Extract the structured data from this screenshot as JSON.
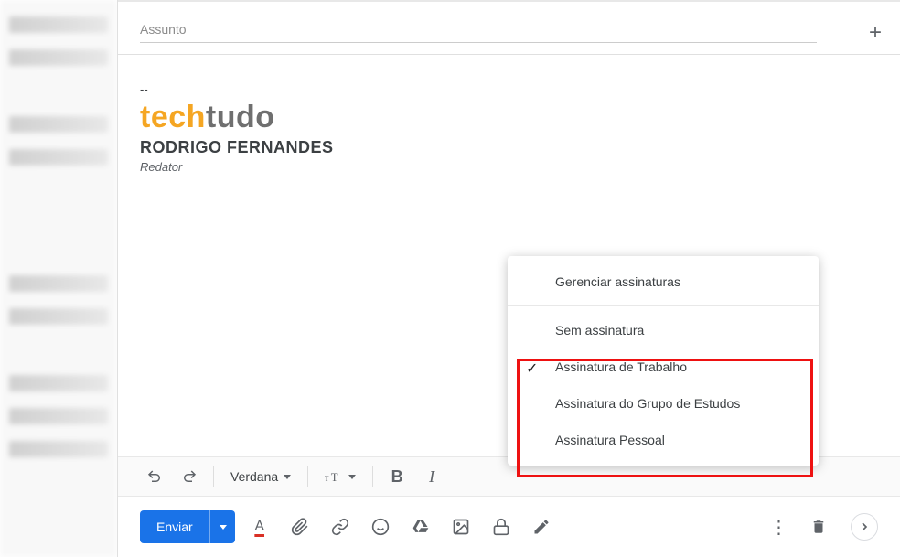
{
  "compose": {
    "subject_placeholder": "Assunto",
    "subject_value": ""
  },
  "signature": {
    "dash": "--",
    "logo": {
      "orange": "tech",
      "gray": "tudo"
    },
    "name": "RODRIGO FERNANDES",
    "role": "Redator"
  },
  "toolbar": {
    "font_name": "Verdana",
    "bold": "B",
    "italic": "I",
    "font_size_label": "𝒯𝒯",
    "underline_a": "A"
  },
  "actions": {
    "send_label": "Enviar"
  },
  "signature_menu": {
    "manage": "Gerenciar assinaturas",
    "none": "Sem assinatura",
    "options": [
      {
        "label": "Assinatura de Trabalho",
        "checked": true
      },
      {
        "label": "Assinatura do Grupo de Estudos",
        "checked": false
      },
      {
        "label": "Assinatura Pessoal",
        "checked": false
      }
    ]
  }
}
